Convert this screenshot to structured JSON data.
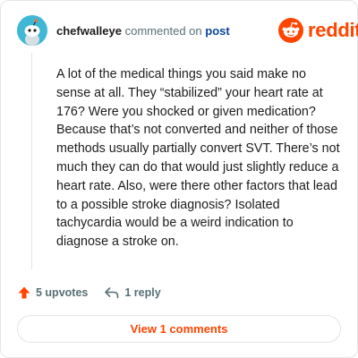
{
  "comment": {
    "username": "chefwalleye",
    "action_text": "commented on",
    "target_link": "post",
    "body": "A lot of the medical things you said make no sense at all. They “stabilized” your heart rate at 176? Were you shocked or given medication? Because that’s not converted and neither of those methods usually partially convert SVT. There’s not much they can do that would just slightly reduce a heart rate. Also, were there other factors that lead to a possible stroke diagnosis? Isolated tachycardia would be a weird indication to diagnose a stroke on.",
    "upvotes_label": "5 upvotes",
    "replies_label": "1 reply"
  },
  "brand": {
    "name": "reddit",
    "color": "#ff4500"
  },
  "footer": {
    "view_comments_label": "View 1 comments"
  },
  "icons": {
    "avatar": "snoo-avatar",
    "logo": "reddit-snoo-logo",
    "upvote": "upvote-arrow-icon",
    "reply": "reply-arrow-icon"
  }
}
